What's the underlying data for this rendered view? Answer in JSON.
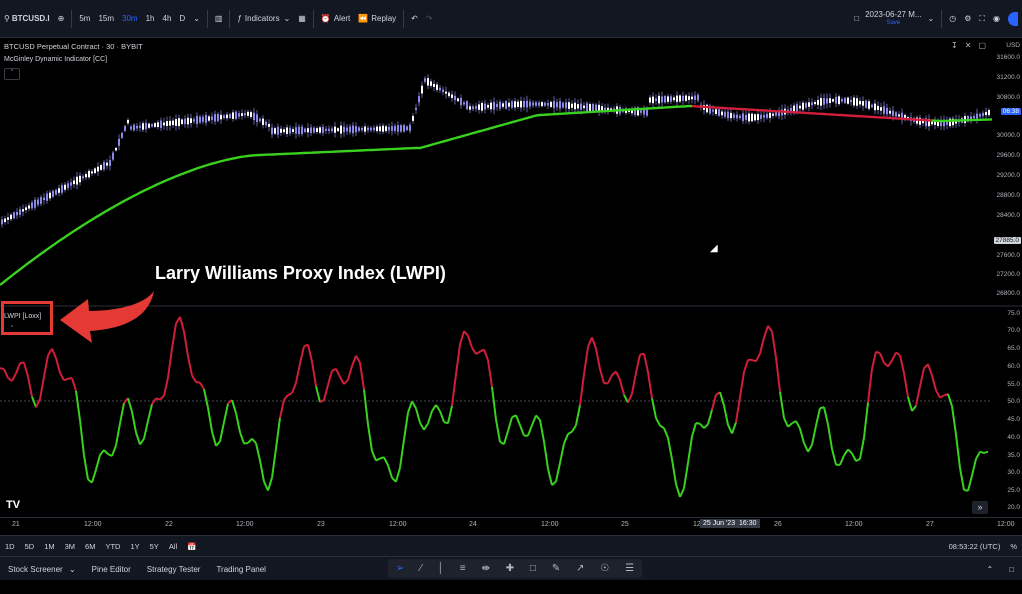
{
  "toolbar": {
    "symbol": "BTCUSD.I",
    "timeframes": [
      "5m",
      "15m",
      "30m",
      "1h",
      "4h",
      "D"
    ],
    "active_timeframe": "30m",
    "indicators_label": "Indicators",
    "alert_label": "Alert",
    "replay_label": "Replay",
    "date_label": "2023-06-27 M...",
    "date_sub": "Save"
  },
  "chart": {
    "title": "BTCUSD Perpetual Contract · 30 · BYBIT",
    "indicator1": "McGinley Dynamic Indicator [CC]",
    "indicator2": "LWPI [Loxx]",
    "currency": "USD",
    "price_ticks": [
      "31600.0",
      "31200.0",
      "30800.0",
      "30400.0",
      "30000.0",
      "29600.0",
      "29200.0",
      "28800.0",
      "28400.0",
      "28000.0",
      "27600.0",
      "27200.0",
      "26800.0"
    ],
    "price_tag_time": "06:38",
    "price_tag_level": "27885.0",
    "osc_ticks": [
      "75.0",
      "70.0",
      "65.0",
      "60.0",
      "55.0",
      "50.0",
      "45.0",
      "40.0",
      "35.0",
      "30.0",
      "25.0",
      "20.0"
    ],
    "time_labels": [
      "21",
      "12:00",
      "22",
      "12:00",
      "23",
      "12:00",
      "24",
      "12:00",
      "25",
      "12:",
      "25 Jun '23",
      "16:30",
      "26",
      "12:00",
      "27",
      "12:00"
    ],
    "annotation": "Larry Williams Proxy Index (LWPI)"
  },
  "colors": {
    "bull": "#39d11e",
    "bear": "#d11e3a",
    "candle": "#8c88e6",
    "accent": "#2962ff",
    "annotation_red": "#e53935"
  },
  "bottom": {
    "ranges": [
      "1D",
      "5D",
      "1M",
      "3M",
      "6M",
      "YTD",
      "1Y",
      "5Y",
      "All"
    ],
    "clock": "08:53:22 (UTC)",
    "percent": "%"
  },
  "panels": {
    "items": [
      "Stock Screener",
      "Pine Editor",
      "Strategy Tester",
      "Trading Panel"
    ]
  }
}
